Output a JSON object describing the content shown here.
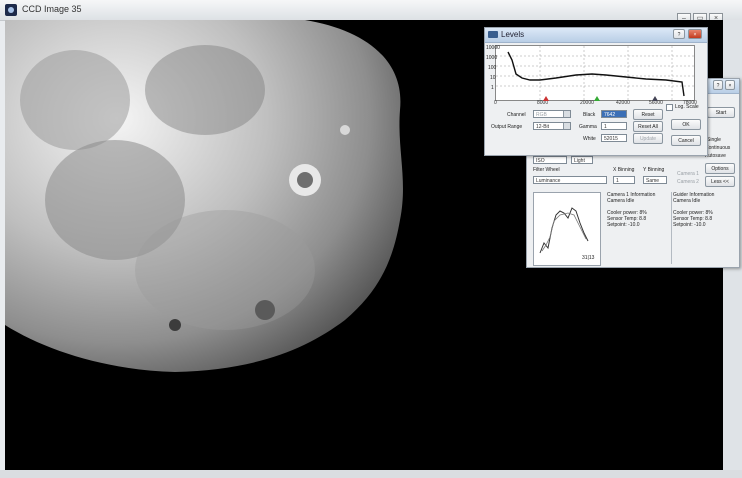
{
  "window": {
    "title": "CCD Image 35",
    "min": "–",
    "max": "▭",
    "close": "×"
  },
  "levels": {
    "title": "Levels",
    "help": "?",
    "close": "×",
    "y_ticks": [
      "10000",
      "1000",
      "100",
      "10",
      "1"
    ],
    "x_ticks": [
      "0",
      "8000",
      "20000",
      "42000",
      "56000",
      "78000"
    ],
    "log_scale_label": "Log. Scale",
    "channel_label": "Channel",
    "channel_value": "RGB",
    "output_range_label": "Output Range",
    "output_range_value": "12-Bit",
    "black_label": "Black",
    "black_value": "7642",
    "gamma_label": "Gamma",
    "gamma_value": "1",
    "white_label": "White",
    "white_value": "52015",
    "reset_label": "Reset",
    "reset_all_label": "Reset All",
    "update_label": "Update",
    "ok_label": "OK",
    "cancel_label": "Cancel"
  },
  "camera": {
    "help": "?",
    "close": "×",
    "start_label": "Start",
    "single_label": "Single",
    "continuous_label": "Continuous",
    "autosave_label": "Autosave",
    "options_label": "Options",
    "less_label": "Less <<",
    "iso_value": "ISO",
    "frame_value": "Light",
    "filter_wheel_label": "Filter Wheel",
    "filter_value": "Luminance",
    "xbin_label": "X Binning",
    "ybin_label": "Y Binning",
    "xbin_value": "1",
    "ybin_value": "Same",
    "camera1_label": "Camera 1",
    "camera2_label": "Camera 2",
    "cam1_info": [
      "Camera 1 Information",
      "Camera Idle",
      "",
      "Cooler power: 8%",
      "Sensor Temp: 8.8",
      "Setpoint: -10.0"
    ],
    "guider_info": [
      "Guider Information",
      "Camera Idle",
      "",
      "Cooler power: 8%",
      "Sensor Temp: 8.8",
      "Setpoint: -10.0"
    ],
    "graph_counter": "31|13"
  }
}
